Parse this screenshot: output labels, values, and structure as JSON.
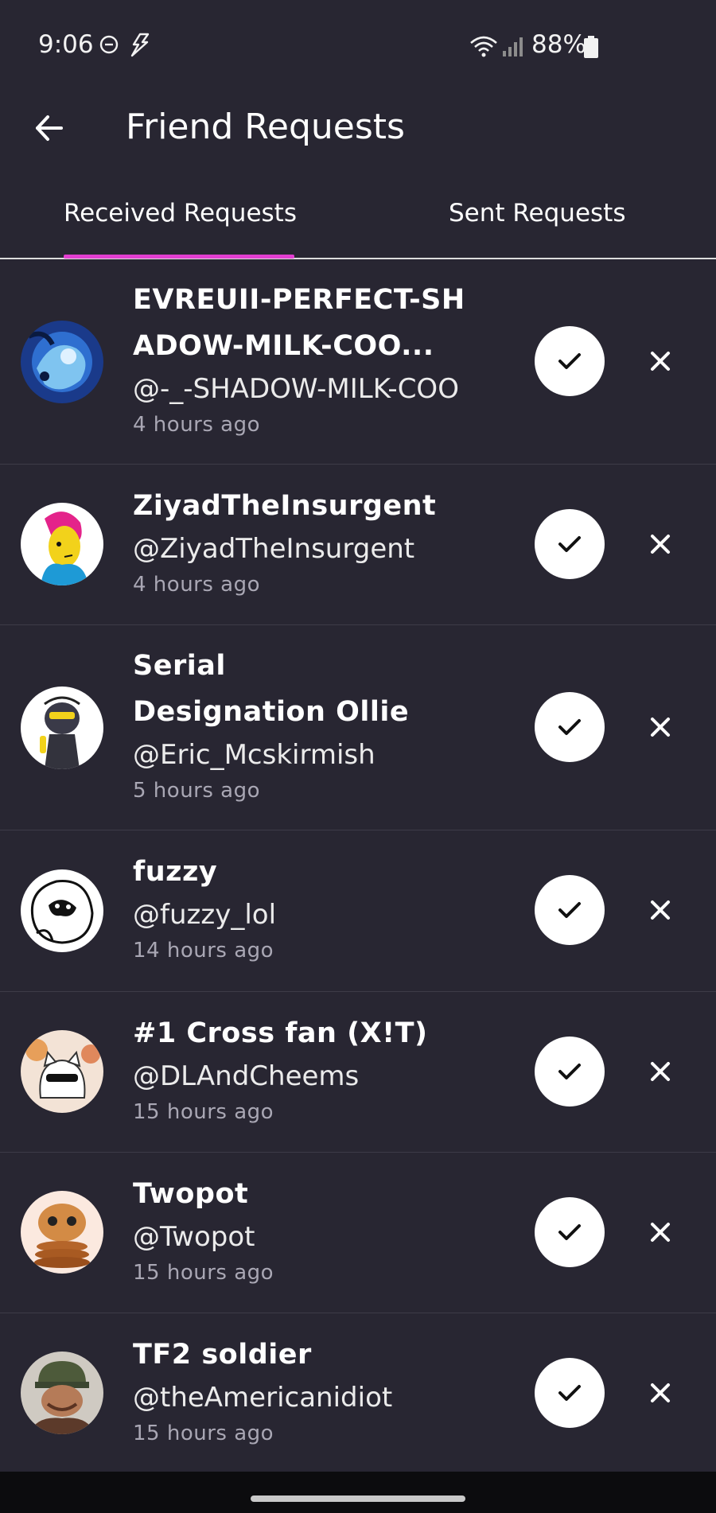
{
  "status_bar": {
    "time": "9:06",
    "battery": "88%"
  },
  "header": {
    "title": "Friend Requests"
  },
  "tabs": [
    {
      "label": "Received Requests",
      "active": true
    },
    {
      "label": "Sent Requests",
      "active": false
    }
  ],
  "requests": [
    {
      "display_name": "EVREUII-PERFECT-SHADOW-MILK-COO...",
      "username": "@-_-SHADOW-MILK-COO",
      "time": "4 hours ago"
    },
    {
      "display_name": "ZiyadTheInsurgent",
      "username": "@ZiyadTheInsurgent",
      "time": "4 hours ago"
    },
    {
      "display_name": "Serial Designation Ollie",
      "username": "@Eric_Mcskirmish",
      "time": "5 hours ago"
    },
    {
      "display_name": "fuzzy",
      "username": "@fuzzy_lol",
      "time": "14 hours ago"
    },
    {
      "display_name": "#1 Cross fan (X!T)",
      "username": "@DLAndCheems",
      "time": "15 hours ago"
    },
    {
      "display_name": "Twopot",
      "username": "@Twopot",
      "time": "15 hours ago"
    },
    {
      "display_name": "TF2 soldier",
      "username": "@theAmericanidiot",
      "time": "15 hours ago"
    }
  ],
  "colors": {
    "background": "#282632",
    "tab_indicator": "#e23fd1",
    "secondary_text": "#a9a7b4"
  }
}
